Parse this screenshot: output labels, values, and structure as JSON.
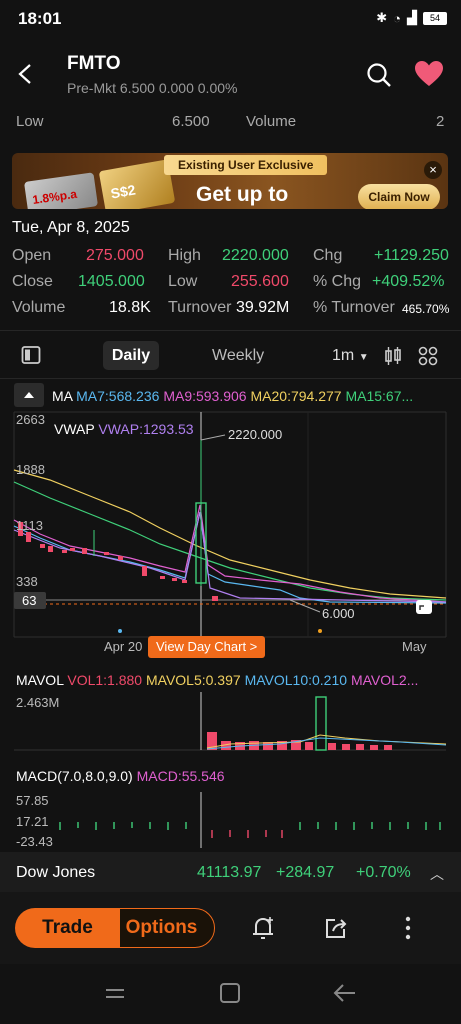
{
  "status": {
    "time": "18:01",
    "battery": "54"
  },
  "header": {
    "ticker": "FMTO",
    "premkt_label": "Pre-Mkt",
    "premkt_price": "6.500",
    "premkt_change": "0.000",
    "premkt_pct": "0.00%"
  },
  "lowrow": {
    "low_label": "Low",
    "low_value": "6.500",
    "volume_label": "Volume",
    "volume_value": "2"
  },
  "banner": {
    "tag": "Existing User Exclusive",
    "headline": "Get up to",
    "claim": "Claim Now",
    "card1": "1.8%p.a",
    "card2": "S$2"
  },
  "date": "Tue, Apr 8, 2025",
  "stats": {
    "open_label": "Open",
    "open": "275.000",
    "high_label": "High",
    "high": "2220.000",
    "chg_label": "Chg",
    "chg": "+1129.250",
    "close_label": "Close",
    "close": "1405.000",
    "low_label": "Low",
    "low": "255.600",
    "pchg_label": "% Chg",
    "pchg": "+409.52%",
    "volume_label": "Volume",
    "volume": "18.8K",
    "turnover_label": "Turnover",
    "turnover": "39.92M",
    "pturn_label": "% Turnover",
    "pturn": "465.70%"
  },
  "toolbar": {
    "daily": "Daily",
    "weekly": "Weekly",
    "interval": "1m"
  },
  "ma": {
    "label": "MA",
    "ma7": "MA7:568.236",
    "ma9": "MA9:593.906",
    "ma20": "MA20:794.277",
    "ma15": "MA15:67..."
  },
  "vwap": {
    "label": "VWAP",
    "value": "VWAP:1293.53"
  },
  "chart": {
    "y_labels": [
      "2663",
      "1888",
      "1113",
      "338"
    ],
    "current": "63",
    "high_marker": "2220.000",
    "low_marker": "6.000",
    "x_labels": [
      "Apr 20",
      "May"
    ],
    "view_day": "View Day Chart >"
  },
  "mavol": {
    "label": "MAVOL",
    "vol1": "VOL1:1.880",
    "vol5": "MAVOL5:0.397",
    "vol10": "MAVOL10:0.210",
    "vol20": "MAVOL2...",
    "ymax": "2.463M"
  },
  "macd": {
    "label": "MACD(7.0,8.0,9.0)",
    "value": "MACD:55.546",
    "y1": "57.85",
    "y2": "17.21",
    "y3": "-23.43"
  },
  "dow": {
    "name": "Dow Jones",
    "price": "41113.97",
    "change": "+284.97",
    "pct": "+0.70%"
  },
  "bottom": {
    "trade": "Trade",
    "options": "Options"
  },
  "colors": {
    "accent": "#f06a1a",
    "up": "#3fd07a",
    "down": "#f04a6a",
    "ma7": "#5ab8f0",
    "ma9": "#e060d0",
    "ma20": "#f0d060",
    "ma15": "#3fd07a",
    "vwap": "#b080f0"
  }
}
